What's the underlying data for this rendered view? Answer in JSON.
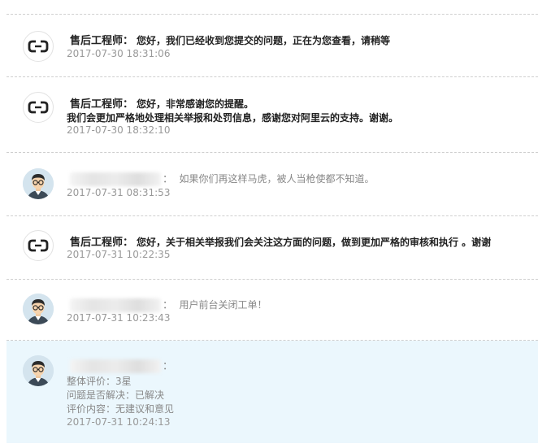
{
  "messages": [
    {
      "sender": "售后工程师：",
      "content": "您好，我们已经收到您提交的问题，正在为您查看，请稍等",
      "time": "2017-07-30 18:31:06"
    },
    {
      "sender": "售后工程师：",
      "content": "您好，非常感谢您的提醒。",
      "content_line2": "我们会更加严格地处理相关举报和处罚信息，感谢您对阿里云的支持。谢谢。",
      "time": "2017-07-30 18:32:10"
    },
    {
      "colon": "：",
      "content": "如果你们再这样马虎，被人当枪使都不知道。",
      "time": "2017-07-31 08:31:53"
    },
    {
      "sender": "售后工程师：",
      "content": "您好，关于相关举报我们会关注这方面的问题，做到更加严格的审核和执行 。谢谢",
      "time": "2017-07-31 10:22:35"
    },
    {
      "colon": "：",
      "content": "用户前台关闭工单！",
      "time": "2017-07-31 10:23:43"
    },
    {
      "colon": "：",
      "rating": "整体评价：3星",
      "resolved": "问题是否解决：已解决",
      "comment": "评价内容：无建议和意见",
      "time": "2017-07-31 10:24:13"
    }
  ],
  "colors": {
    "highlight_bg": "#ebf7fd",
    "divider": "#cfcfcf",
    "time_text": "#999999"
  },
  "icons": {
    "engineer_avatar": "aliyun-logo-icon",
    "user_avatar": "user-avatar-icon"
  }
}
